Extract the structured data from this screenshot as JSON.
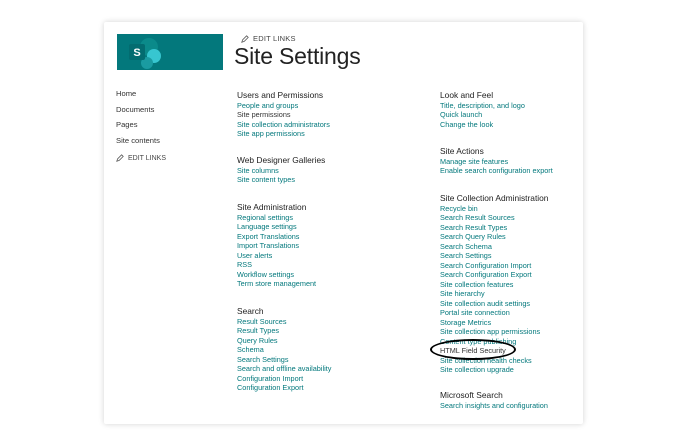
{
  "header": {
    "logo_letter": "S",
    "edit_links": "EDIT LINKS",
    "title": "Site Settings"
  },
  "leftnav": {
    "items": [
      "Home",
      "Documents",
      "Pages",
      "Site contents"
    ],
    "edit_links": "EDIT LINKS"
  },
  "sections": {
    "users": {
      "title": "Users and Permissions",
      "links": [
        "People and groups",
        "Site permissions",
        "Site collection administrators",
        "Site app permissions"
      ]
    },
    "web_designer": {
      "title": "Web Designer Galleries",
      "links": [
        "Site columns",
        "Site content types"
      ]
    },
    "site_admin": {
      "title": "Site Administration",
      "links": [
        "Regional settings",
        "Language settings",
        "Export Translations",
        "Import Translations",
        "User alerts",
        "RSS",
        "Workflow settings",
        "Term store management"
      ]
    },
    "search": {
      "title": "Search",
      "links": [
        "Result Sources",
        "Result Types",
        "Query Rules",
        "Schema",
        "Search Settings",
        "Search and offline availability",
        "Configuration Import",
        "Configuration Export"
      ]
    },
    "look_feel": {
      "title": "Look and Feel",
      "links": [
        "Title, description, and logo",
        "Quick launch",
        "Change the look"
      ]
    },
    "site_actions": {
      "title": "Site Actions",
      "links": [
        "Manage site features",
        "Enable search configuration export"
      ]
    },
    "site_collection_admin": {
      "title": "Site Collection Administration",
      "links": [
        "Recycle bin",
        "Search Result Sources",
        "Search Result Types",
        "Search Query Rules",
        "Search Schema",
        "Search Settings",
        "Search Configuration Import",
        "Search Configuration Export",
        "Site collection features",
        "Site hierarchy",
        "Site collection audit settings",
        "Portal site connection",
        "Storage Metrics",
        "Site collection app permissions",
        "Content type publishing",
        "HTML Field Security",
        "Site collection health checks",
        "Site collection upgrade"
      ]
    },
    "microsoft_search": {
      "title": "Microsoft Search",
      "links": [
        "Search insights and configuration"
      ]
    }
  },
  "colors": {
    "brand": "#03787c",
    "link": "#03787c"
  }
}
